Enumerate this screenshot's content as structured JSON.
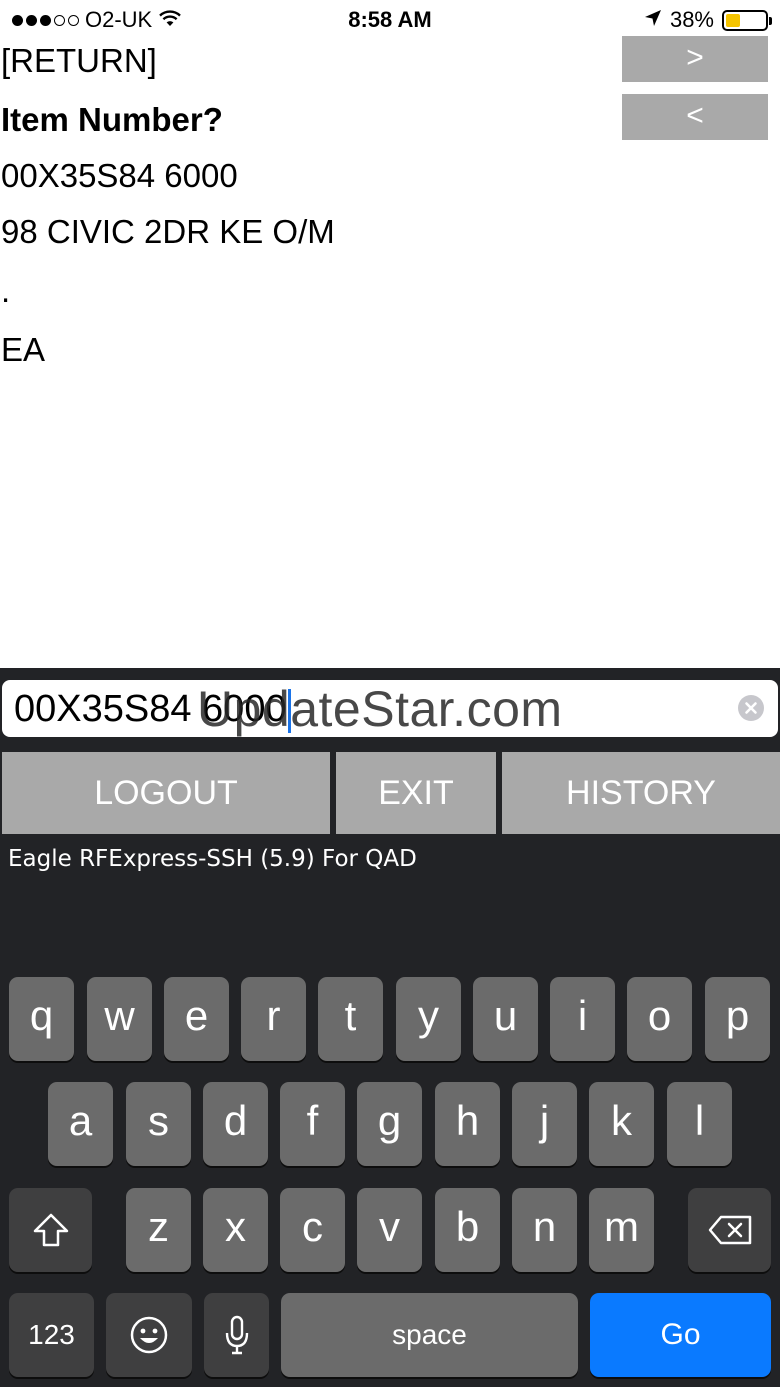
{
  "status_bar": {
    "carrier": "O2-UK",
    "time": "8:58 AM",
    "battery_percent": "38%",
    "battery_level": 0.38,
    "signal_bars_filled": 3,
    "signal_bars_total": 5,
    "icons": [
      "wifi-icon",
      "location-arrow-icon",
      "battery-icon"
    ]
  },
  "terminal": {
    "lines": [
      "[RETURN]",
      "Item Number?",
      "00X35S84 6000",
      "98 CIVIC 2DR KE O/M",
      ".",
      "EA"
    ],
    "next_button": ">",
    "prev_button": "<"
  },
  "input": {
    "value": "00X35S84 6000",
    "watermark": "UpdateStar.com"
  },
  "actions": {
    "logout": "LOGOUT",
    "exit": "EXIT",
    "history": "HISTORY"
  },
  "app_caption": "Eagle RFExpress-SSH (5.9) For QAD",
  "keyboard": {
    "row1": [
      "q",
      "w",
      "e",
      "r",
      "t",
      "y",
      "u",
      "i",
      "o",
      "p"
    ],
    "row2": [
      "a",
      "s",
      "d",
      "f",
      "g",
      "h",
      "j",
      "k",
      "l"
    ],
    "row3": [
      "z",
      "x",
      "c",
      "v",
      "b",
      "n",
      "m"
    ],
    "numbers_key": "123",
    "space_key": "space",
    "go_key": "Go"
  },
  "colors": {
    "button_gray": "#a9a9a9",
    "keyboard_bg": "#222326",
    "key_bg": "#6b6b6b",
    "go_blue": "#0a7aff",
    "caret_blue": "#1a73e8",
    "battery_yellow": "#f5c400"
  }
}
